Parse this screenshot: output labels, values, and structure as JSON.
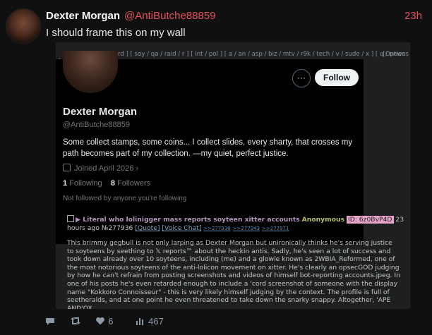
{
  "tweet": {
    "name": "Dexter Morgan",
    "handle": "@AntiButche88859",
    "time": "23h",
    "text": "I should frame this on my wall"
  },
  "embed": {
    "navbar": "[ home / overboard ] [ soy / qa / raid / r ] [ int / pol ] [ a / an / asp / biz / mtv / r9k / tech / v / sude / x ] [ q / news / chive / rules / pass\n/ bans / status ] [ wiki / booru / irc ]",
    "options": "[Options",
    "profile": {
      "follow_label": "Follow",
      "more_glyph": "···",
      "name": "Dexter Morgan",
      "handle": "@AntiButche88859",
      "bio": "Some collect stamps, some coins... I collect slides, every sharty, that crosses my path becomes part of my collection. —my quiet, perfect justice.",
      "joined": "Joined April 2026",
      "following_count": "1",
      "following_label": "Following",
      "followers_count": "8",
      "followers_label": "Followers",
      "not_followed": "Not followed by anyone you're following"
    },
    "post": {
      "subject": "▶ Literal who lolinigger mass reports soyteen xitter accounts",
      "author": "Anonymous",
      "id": "ID: 6z0BvP4D",
      "time": "23 hours ago",
      "number": "№277936",
      "quote": "[Quote]",
      "voice": "[Voice Chat]",
      "replies": [
        ">>277938",
        ">>277943",
        ">>277971"
      ],
      "body": "This brimmy gegbull is not only larping as Dexter Morgan but unironically thinks he's serving justice to soyteens by seething to 𝕏 reports™ about the heckin antis. Sadly, he's seen a lot of success and took down already over 10 soyteens, including (me) and a glowie known as 2WBIA_Reformed, one of the most notorious soyteens of the anti-lolicon movement on xitter. He's clearly an opsecGOD judging by how he can't refrain from posting screenshots and videos of himself bot-reporting accounts.jpeg. In one of his posts he's even retarded enough to include a 'cord screenshot of someone with the display name \"Kokkoro Connoisseur\" - this is very likely himself judging by the context. The profile is full of seetheralds, and at one point he even threatened to take down the snarky snappy. Altogether, 'APE AND'OX"
    }
  },
  "actions": {
    "likes": "6",
    "views": "467"
  }
}
